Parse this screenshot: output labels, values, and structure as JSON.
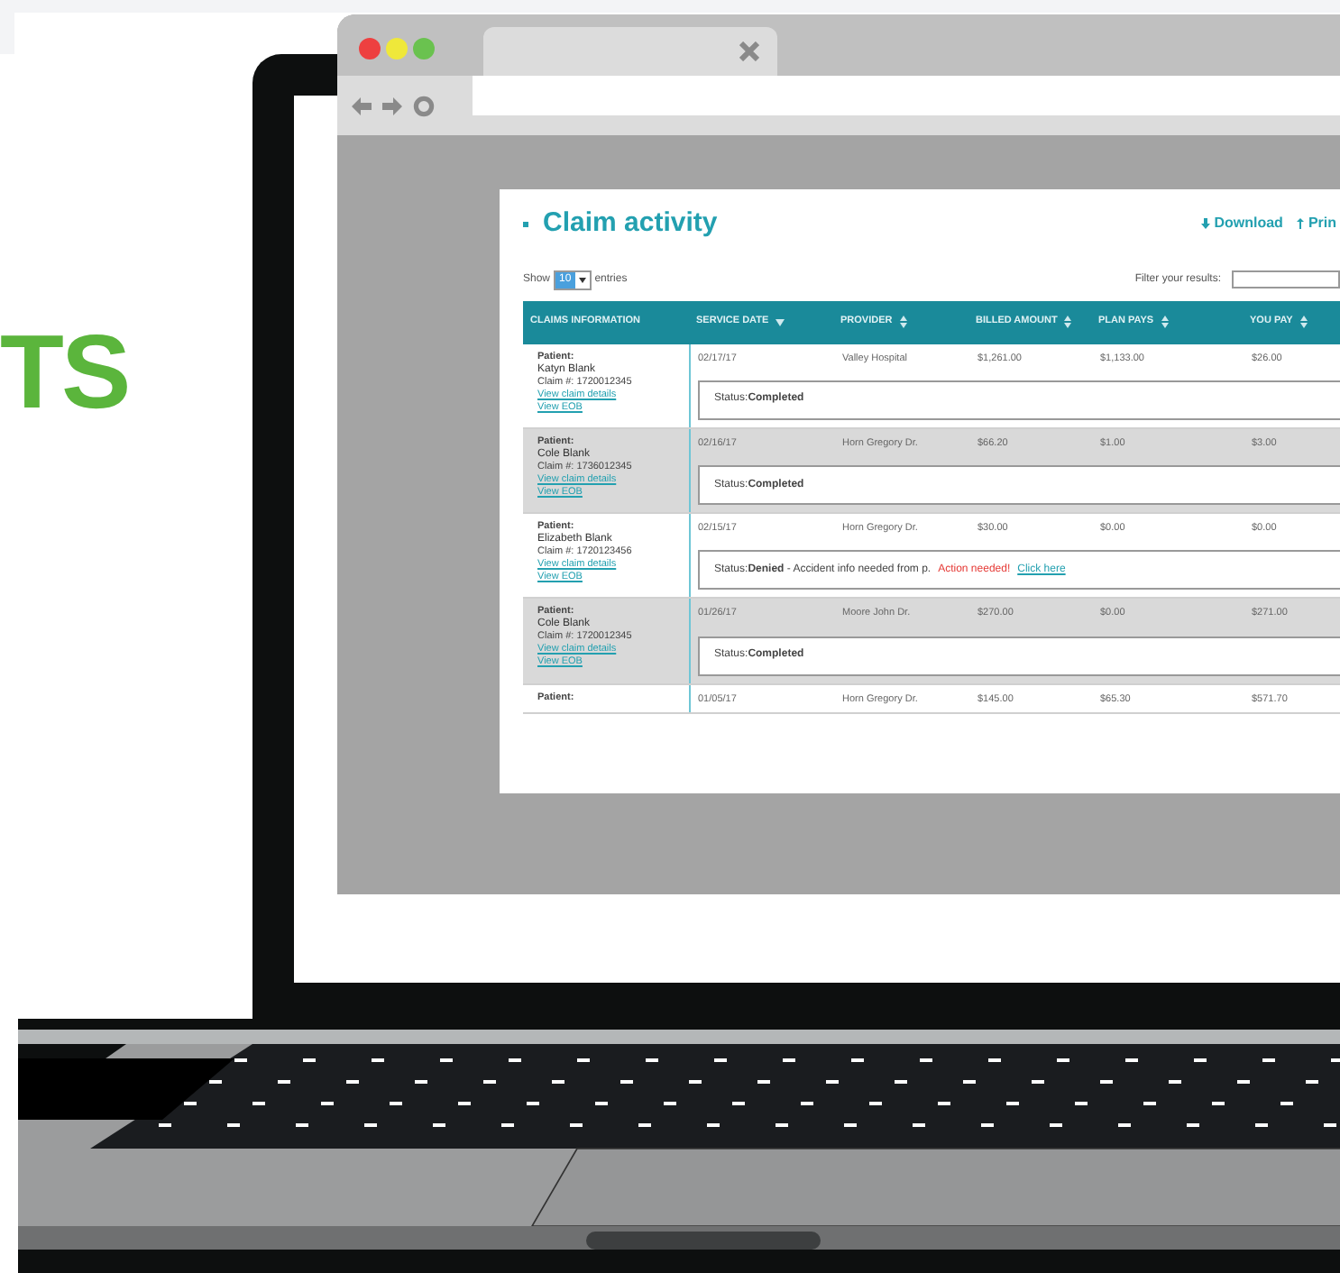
{
  "headline": "TS",
  "page": {
    "title": "Claim activity",
    "actions": [
      {
        "label": "Download"
      },
      {
        "label": "Prin"
      }
    ],
    "show": {
      "before": "Show",
      "value": "10",
      "after": "entries"
    },
    "filter": {
      "label": "Filter your results:"
    }
  },
  "table": {
    "columns": [
      {
        "label": "CLAIMS INFORMATION",
        "kind": "plain"
      },
      {
        "label": "SERVICE DATE",
        "kind": "sorted"
      },
      {
        "label": "PROVIDER",
        "kind": "sortable"
      },
      {
        "label": "BILLED AMOUNT",
        "kind": "sortable"
      },
      {
        "label": "PLAN PAYS",
        "kind": "sortable"
      },
      {
        "label": "YOU PAY",
        "kind": "sortable"
      }
    ],
    "rows": [
      {
        "patient": "Patient:",
        "name": "Katyn Blank",
        "claim": "Claim #: 1720012345",
        "links": [
          "View claim details",
          "View EOB"
        ],
        "service_date": "02/17/17",
        "provider": "Valley Hospital",
        "billed_amount": "$1,261.00",
        "plan_pays": "$1,133.00",
        "you_pay": "$26.00",
        "status": {
          "label": "Status:",
          "value": "Completed"
        }
      },
      {
        "patient": "Patient:",
        "name": "Cole Blank",
        "claim": "Claim #: 1736012345",
        "links": [
          "View claim details",
          "View EOB"
        ],
        "service_date": "02/16/17",
        "provider": "Horn Gregory Dr.",
        "billed_amount": "$66.20",
        "plan_pays": "$1.00",
        "you_pay": "$3.00",
        "status": {
          "label": "Status:",
          "value": "Completed"
        }
      },
      {
        "patient": "Patient:",
        "name": "Elizabeth Blank",
        "claim": "Claim #: 1720123456",
        "links": [
          "View claim details",
          "View EOB"
        ],
        "service_date": "02/15/17",
        "provider": "Horn Gregory Dr.",
        "billed_amount": "$30.00",
        "plan_pays": "$0.00",
        "you_pay": "$0.00",
        "status": {
          "label": "Status:",
          "value": "Denied",
          "note": " - Accident info needed from p.",
          "alert": "Action needed!",
          "link": "Click here"
        }
      },
      {
        "patient": "Patient:",
        "name": "Cole Blank",
        "claim": "Claim #: 1720012345",
        "links": [
          "View claim details",
          "View EOB"
        ],
        "service_date": "01/26/17",
        "provider": "Moore John Dr.",
        "billed_amount": "$270.00",
        "plan_pays": "$0.00",
        "you_pay": "$271.00",
        "status": {
          "label": "Status:",
          "value": "Completed"
        }
      },
      {
        "patient": "Patient:",
        "links": [],
        "service_date": "01/05/17",
        "provider": "Horn Gregory Dr.",
        "billed_amount": "$145.00",
        "plan_pays": "$65.30",
        "you_pay": "$571.70"
      }
    ]
  }
}
